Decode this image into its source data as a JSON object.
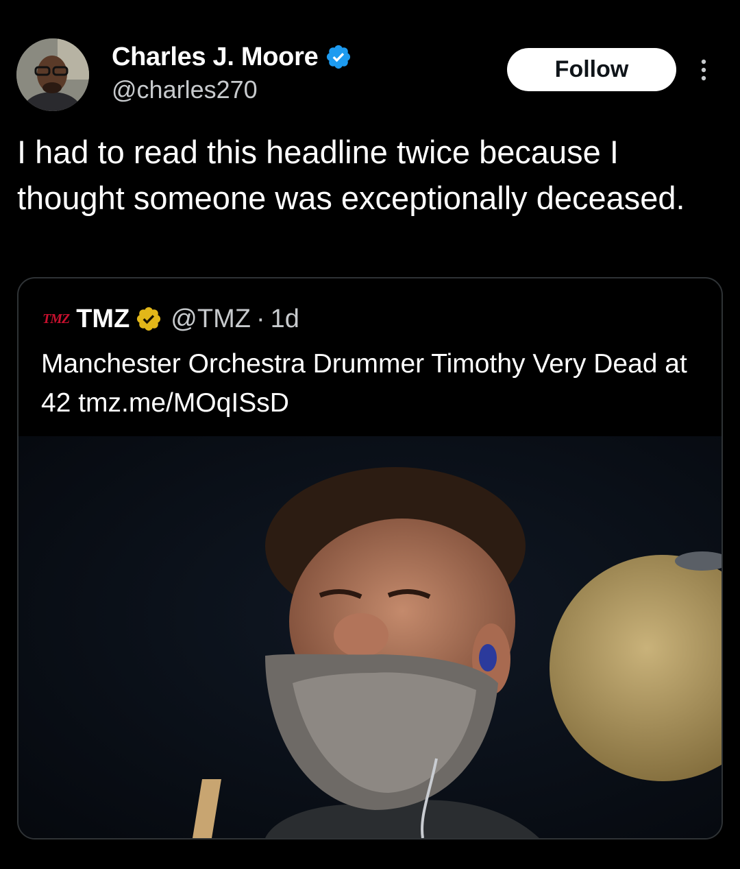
{
  "author": {
    "name": "Charles J. Moore",
    "handle": "@charles270",
    "verified_icon": "blue-verified-badge-icon",
    "avatar_icon": "user-avatar"
  },
  "follow_button": {
    "label": "Follow"
  },
  "more_button": {
    "icon": "more-vertical-icon"
  },
  "tweet": {
    "text": "I had to read this headline twice because I thought someone was exceptionally deceased."
  },
  "quoted_tweet": {
    "logo_text": "TMZ",
    "name": "TMZ",
    "verified_icon": "gold-verified-badge-icon",
    "handle": "@TMZ",
    "separator": "·",
    "time": "1d",
    "text": "Manchester Orchestra Drummer Timothy Very Dead at 42 tmz.me/MOqISsD",
    "image": "photo of bearded drummer smiling next to a cymbal"
  },
  "colors": {
    "background": "#000000",
    "text": "#ffffff",
    "muted": "#c7cacd",
    "verified_blue": "#1d9bf0",
    "verified_gold": "#e2b719",
    "card_border": "#2f3336",
    "tmz_red": "#c8102e"
  }
}
